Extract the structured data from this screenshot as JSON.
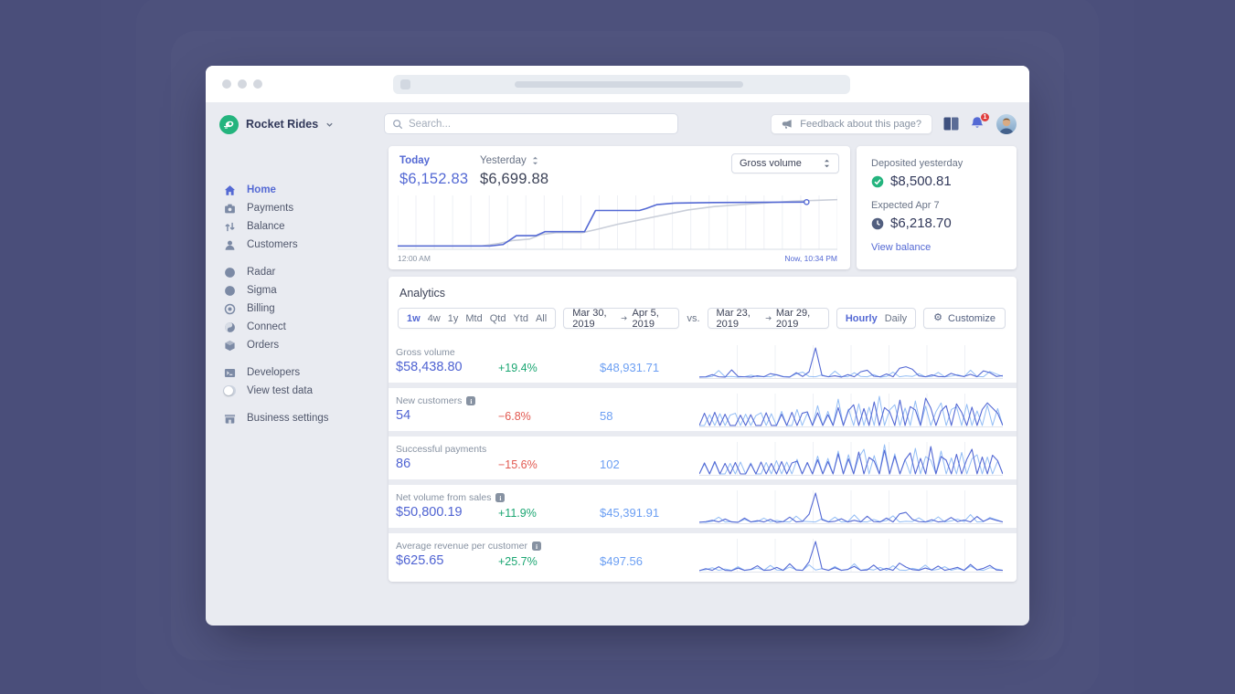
{
  "topbar": {
    "search_placeholder": "Search...",
    "feedback_label": "Feedback about this page?",
    "notification_count": "1"
  },
  "sidebar": {
    "account_name": "Rocket Rides",
    "sections": [
      [
        {
          "label": "Home",
          "icon": "home",
          "active": true
        },
        {
          "label": "Payments",
          "icon": "payments"
        },
        {
          "label": "Balance",
          "icon": "balance"
        },
        {
          "label": "Customers",
          "icon": "customers"
        }
      ],
      [
        {
          "label": "Radar",
          "icon": "radar"
        },
        {
          "label": "Sigma",
          "icon": "sigma"
        },
        {
          "label": "Billing",
          "icon": "billing"
        },
        {
          "label": "Connect",
          "icon": "connect"
        },
        {
          "label": "Orders",
          "icon": "orders"
        }
      ],
      [
        {
          "label": "Developers",
          "icon": "developers"
        },
        {
          "label": "View test data",
          "icon": "toggle",
          "toggle": true
        }
      ],
      [
        {
          "label": "Business settings",
          "icon": "settings"
        }
      ]
    ]
  },
  "overview": {
    "today_label": "Today",
    "today_value": "$6,152.83",
    "yesterday_label": "Yesterday",
    "yesterday_value": "$6,699.88",
    "metric_select_value": "Gross volume",
    "x_start": "12:00 AM",
    "x_end": "Now, 10:34 PM"
  },
  "deposits": {
    "deposited_label": "Deposited yesterday",
    "deposited_value": "$8,500.81",
    "expected_label": "Expected Apr 7",
    "expected_value": "$6,218.70",
    "link_label": "View balance"
  },
  "analytics": {
    "title": "Analytics",
    "range_tabs": [
      "1w",
      "4w",
      "1y",
      "Mtd",
      "Qtd",
      "Ytd",
      "All"
    ],
    "active_tab": "1w",
    "date_range_1": {
      "start": "Mar 30, 2019",
      "end": "Apr 5, 2019"
    },
    "vs_label": "vs.",
    "date_range_2": {
      "start": "Mar 23, 2019",
      "end": "Mar 29, 2019"
    },
    "granularity_options": [
      "Hourly",
      "Daily"
    ],
    "active_granularity": "Hourly",
    "customize_label": "Customize",
    "metrics": [
      {
        "label": "Gross volume",
        "info": false,
        "value": "$58,438.80",
        "change": "+19.4%",
        "change_dir": "up",
        "compare": "$48,931.71",
        "spark": {
          "current": [
            0.3,
            0.4,
            1.1,
            0.4,
            0.3,
            2.6,
            0.5,
            0.4,
            0.3,
            0.7,
            0.4,
            1.4,
            1.0,
            0.4,
            0.3,
            1.7,
            0.5,
            2.0,
            9.6,
            0.8,
            0.4,
            0.7,
            0.3,
            1.1,
            0.4,
            2.0,
            2.5,
            0.6,
            0.4,
            1.3,
            0.4,
            3.1,
            3.6,
            2.8,
            0.7,
            0.4,
            1.0,
            0.5,
            0.4,
            1.5,
            0.8,
            0.5,
            1.2,
            0.4,
            2.3,
            1.7,
            0.5,
            0.8
          ],
          "previous": [
            0.4,
            0.3,
            0.5,
            2.4,
            0.4,
            0.5,
            0.3,
            0.4,
            0.9,
            0.4,
            0.5,
            0.4,
            1.1,
            0.5,
            0.4,
            1.3,
            1.9,
            0.5,
            0.4,
            1.0,
            0.4,
            2.2,
            0.5,
            0.4,
            1.7,
            0.5,
            0.4,
            1.1,
            0.3,
            0.5,
            1.9,
            0.4,
            0.7,
            0.5,
            1.4,
            0.4,
            0.5,
            1.8,
            0.4,
            0.6,
            1.1,
            0.4,
            2.5,
            0.5,
            0.4,
            2.1,
            1.3,
            0.5
          ]
        }
      },
      {
        "label": "New customers",
        "info": true,
        "value": "54",
        "change": "−6.8%",
        "change_dir": "down",
        "compare": "58",
        "spark": {
          "current": [
            0.2,
            2.8,
            0.2,
            3.0,
            0.2,
            2.6,
            0.2,
            0.2,
            2.4,
            0.2,
            2.5,
            0.2,
            0.2,
            2.9,
            0.2,
            0.2,
            2.6,
            0.2,
            3.0,
            0.2,
            2.8,
            3.1,
            0.2,
            2.9,
            0.2,
            2.5,
            0.2,
            4.0,
            0.2,
            3.4,
            4.6,
            0.2,
            3.8,
            0.2,
            5.2,
            0.2,
            4.0,
            3.1,
            0.2,
            5.6,
            0.2,
            4.2,
            3.5,
            0.2,
            6.0,
            3.9,
            0.2,
            3.3,
            4.4,
            0.2,
            4.8,
            3.0,
            0.2,
            4.1,
            0.2,
            3.6,
            5.0,
            3.9,
            2.8,
            0.2
          ],
          "previous": [
            0.2,
            0.2,
            2.5,
            0.2,
            2.7,
            0.2,
            2.4,
            2.8,
            0.2,
            2.6,
            0.2,
            2.3,
            2.9,
            0.2,
            2.7,
            0.2,
            3.2,
            0.2,
            0.2,
            3.6,
            0.2,
            2.8,
            0.2,
            4.4,
            0.2,
            3.2,
            0.2,
            5.8,
            0.2,
            3.7,
            0.2,
            4.8,
            0.2,
            4.1,
            0.2,
            6.4,
            0.2,
            3.5,
            4.6,
            0.2,
            3.9,
            0.2,
            5.4,
            0.2,
            4.3,
            0.2,
            3.1,
            5.0,
            0.2,
            3.6,
            4.2,
            0.2,
            4.7,
            0.2,
            3.3,
            0.2,
            4.5,
            0.2,
            3.8,
            0.2
          ]
        }
      },
      {
        "label": "Successful payments",
        "info": false,
        "value": "86",
        "change": "−15.6%",
        "change_dir": "down",
        "compare": "102",
        "spark": {
          "current": [
            0.2,
            2.6,
            0.2,
            2.9,
            0.2,
            2.5,
            0.2,
            2.7,
            0.2,
            0.2,
            2.4,
            0.2,
            2.8,
            0.2,
            2.5,
            0.2,
            2.9,
            0.2,
            2.6,
            3.0,
            0.2,
            2.7,
            0.2,
            3.3,
            0.2,
            2.9,
            0.2,
            4.6,
            0.2,
            3.5,
            0.2,
            5.0,
            0.2,
            3.8,
            3.0,
            0.2,
            5.4,
            0.2,
            4.1,
            0.2,
            3.3,
            4.8,
            0.2,
            3.6,
            0.2,
            6.2,
            0.2,
            4.0,
            3.2,
            0.2,
            4.5,
            0.2,
            3.4,
            5.6,
            0.2,
            3.9,
            0.2,
            4.3,
            3.1,
            0.2
          ],
          "previous": [
            0.2,
            2.4,
            0.2,
            2.7,
            0.2,
            0.2,
            2.5,
            0.2,
            2.8,
            0.2,
            2.6,
            0.2,
            0.2,
            2.7,
            0.2,
            3.1,
            0.2,
            2.8,
            0.2,
            3.4,
            0.2,
            2.6,
            0.2,
            4.1,
            0.2,
            3.6,
            0.2,
            5.2,
            0.2,
            4.4,
            0.2,
            3.8,
            5.6,
            0.2,
            4.2,
            0.2,
            6.6,
            0.2,
            4.6,
            0.2,
            3.4,
            0.2,
            5.8,
            0.2,
            4.0,
            3.2,
            0.2,
            5.2,
            0.2,
            3.7,
            0.2,
            4.9,
            0.2,
            3.5,
            4.4,
            0.2,
            3.9,
            0.2,
            3.0,
            0.2
          ]
        }
      },
      {
        "label": "Net volume from sales",
        "info": true,
        "value": "$50,800.19",
        "change": "+11.9%",
        "change_dir": "up",
        "compare": "$45,391.91",
        "spark": {
          "current": [
            0.3,
            0.5,
            0.9,
            0.4,
            1.3,
            0.4,
            0.3,
            1.6,
            0.4,
            0.8,
            0.4,
            1.2,
            0.3,
            0.5,
            1.9,
            0.4,
            0.6,
            2.8,
            9.4,
            1.1,
            0.4,
            0.6,
            1.4,
            0.4,
            0.9,
            0.4,
            2.2,
            0.5,
            0.4,
            1.6,
            0.4,
            2.9,
            3.4,
            1.2,
            0.5,
            0.4,
            1.1,
            0.4,
            0.6,
            1.8,
            0.5,
            1.0,
            0.4,
            2.1,
            0.6,
            1.5,
            0.9,
            0.4
          ],
          "previous": [
            0.4,
            0.3,
            0.6,
            1.9,
            0.4,
            0.5,
            0.3,
            1.2,
            0.4,
            0.5,
            1.6,
            0.4,
            0.9,
            0.5,
            0.4,
            2.2,
            0.6,
            0.5,
            0.4,
            1.4,
            0.5,
            1.9,
            0.4,
            0.5,
            2.6,
            0.5,
            0.4,
            1.2,
            0.5,
            0.8,
            2.3,
            0.4,
            0.6,
            0.5,
            1.7,
            0.4,
            0.5,
            2.0,
            0.4,
            0.7,
            1.3,
            0.5,
            2.7,
            0.4,
            0.5,
            1.8,
            1.1,
            0.4
          ]
        }
      },
      {
        "label": "Average revenue per customer",
        "info": true,
        "value": "$625.65",
        "change": "+25.7%",
        "change_dir": "up",
        "compare": "$497.56",
        "spark": {
          "current": [
            0.3,
            0.9,
            0.4,
            1.5,
            0.4,
            0.3,
            1.1,
            0.4,
            0.7,
            1.8,
            0.4,
            0.5,
            1.3,
            0.4,
            2.4,
            0.5,
            0.4,
            3.0,
            9.2,
            0.9,
            0.4,
            1.2,
            0.4,
            0.7,
            1.6,
            0.4,
            0.5,
            2.0,
            0.4,
            1.0,
            0.4,
            2.6,
            1.4,
            0.6,
            0.4,
            1.1,
            0.5,
            1.7,
            0.4,
            0.8,
            1.3,
            0.4,
            2.2,
            0.5,
            1.0,
            1.9,
            0.5,
            0.4
          ],
          "previous": [
            0.4,
            0.6,
            1.2,
            0.4,
            0.8,
            0.4,
            1.5,
            0.4,
            0.6,
            1.1,
            0.4,
            1.9,
            0.5,
            0.4,
            1.4,
            0.6,
            0.4,
            2.1,
            0.5,
            0.9,
            0.4,
            1.6,
            0.4,
            0.6,
            2.4,
            0.4,
            0.8,
            0.5,
            1.3,
            0.4,
            1.8,
            0.5,
            0.4,
            1.0,
            0.6,
            2.0,
            0.4,
            0.7,
            1.5,
            0.4,
            0.9,
            0.4,
            1.7,
            0.6,
            0.4,
            1.2,
            0.8,
            0.4
          ]
        }
      }
    ]
  },
  "chart_data": {
    "type": "line",
    "title": "Gross volume — Today vs Yesterday",
    "legend": [
      "Today",
      "Yesterday"
    ],
    "x_axis": {
      "start_label": "12:00 AM",
      "end_label": "Now, 10:34 PM"
    },
    "series": [
      {
        "name": "Today",
        "color": "#5469d4",
        "end_marker": true,
        "points": [
          [
            0,
            0.03
          ],
          [
            0.21,
            0.03
          ],
          [
            0.24,
            0.06
          ],
          [
            0.27,
            0.24
          ],
          [
            0.315,
            0.24
          ],
          [
            0.335,
            0.32
          ],
          [
            0.425,
            0.32
          ],
          [
            0.45,
            0.75
          ],
          [
            0.55,
            0.75
          ],
          [
            0.565,
            0.79
          ],
          [
            0.59,
            0.87
          ],
          [
            0.63,
            0.9
          ],
          [
            0.72,
            0.91
          ],
          [
            0.82,
            0.915
          ],
          [
            0.93,
            0.92
          ]
        ]
      },
      {
        "name": "Yesterday",
        "color": "#c9ced9",
        "end_marker": false,
        "points": [
          [
            0,
            0.03
          ],
          [
            0.19,
            0.03
          ],
          [
            0.23,
            0.08
          ],
          [
            0.26,
            0.14
          ],
          [
            0.3,
            0.17
          ],
          [
            0.325,
            0.26
          ],
          [
            0.36,
            0.3
          ],
          [
            0.42,
            0.3
          ],
          [
            0.455,
            0.37
          ],
          [
            0.5,
            0.47
          ],
          [
            0.545,
            0.55
          ],
          [
            0.6,
            0.65
          ],
          [
            0.66,
            0.76
          ],
          [
            0.72,
            0.83
          ],
          [
            0.8,
            0.88
          ],
          [
            0.9,
            0.94
          ],
          [
            1.0,
            0.97
          ]
        ]
      }
    ],
    "grid": {
      "vertical_divisions": 24
    }
  },
  "colors": {
    "accent": "#5469d4",
    "compare_blue": "#6c9ff3",
    "positive_green": "#1ba672",
    "negative_red": "#e25950",
    "brand_green": "#24b47e",
    "spark_previous": "#93bdf5"
  }
}
